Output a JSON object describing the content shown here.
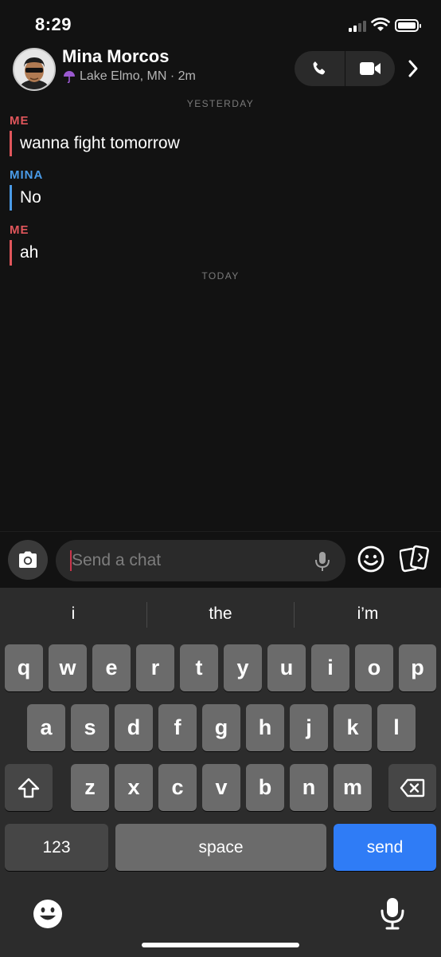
{
  "status_bar": {
    "time": "8:29"
  },
  "header": {
    "name": "Mina Morcos",
    "location": "Lake Elmo, MN · 2m",
    "icons": [
      "phone-icon",
      "video-icon",
      "chevron-right-icon"
    ]
  },
  "colors": {
    "me": "#e0565b",
    "friend": "#4a9be8",
    "send": "#2f7cf6"
  },
  "conversation": {
    "yesterday_label": "YESTERDAY",
    "today_label": "TODAY",
    "messages": [
      {
        "sender": "ME",
        "text": "wanna fight tomorrow"
      },
      {
        "sender": "MINA",
        "text": "No"
      },
      {
        "sender": "ME",
        "text": "ah"
      }
    ]
  },
  "input": {
    "placeholder": "Send a chat"
  },
  "keyboard": {
    "suggestions": [
      "i",
      "the",
      "i’m"
    ],
    "row1": [
      "q",
      "w",
      "e",
      "r",
      "t",
      "y",
      "u",
      "i",
      "o",
      "p"
    ],
    "row2": [
      "a",
      "s",
      "d",
      "f",
      "g",
      "h",
      "j",
      "k",
      "l"
    ],
    "row3": [
      "z",
      "x",
      "c",
      "v",
      "b",
      "n",
      "m"
    ],
    "numbers_label": "123",
    "space_label": "space",
    "send_label": "send"
  }
}
